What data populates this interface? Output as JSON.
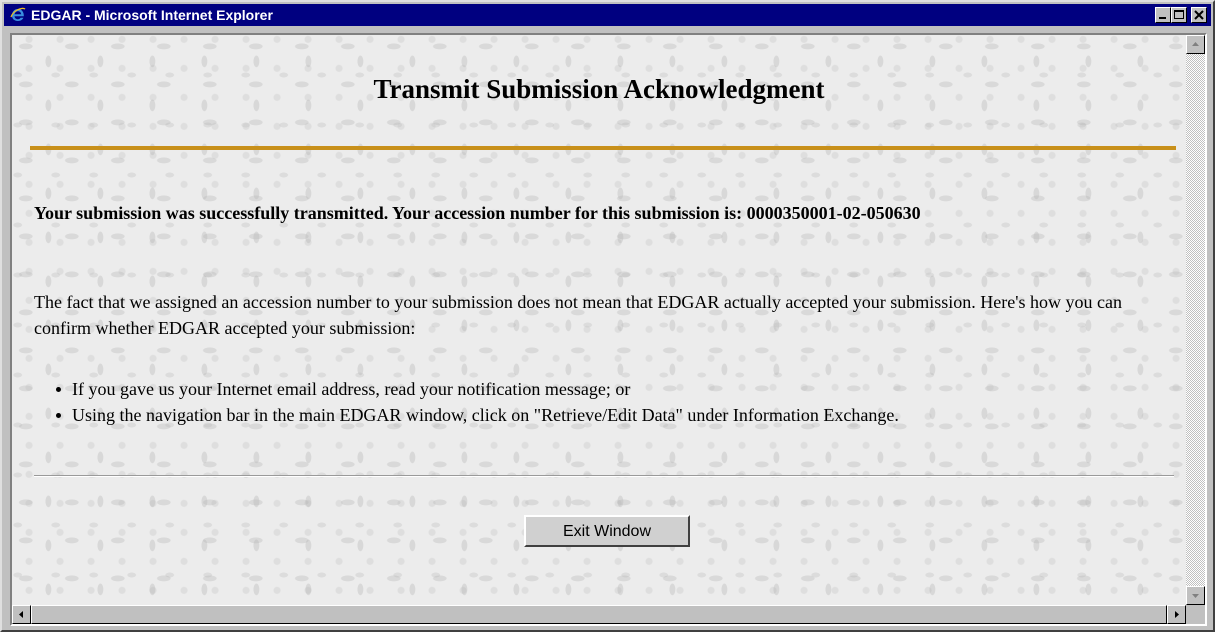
{
  "window": {
    "title": "EDGAR - Microsoft Internet Explorer",
    "icons": [
      "ie-icon",
      "minimize-icon",
      "maximize-icon",
      "close-icon"
    ]
  },
  "page": {
    "title": "Transmit Submission Acknowledgment",
    "notice": "Your submission was successfully transmitted. Your accession number for this submission is: 0000350001-02-050630",
    "body": "The fact that we assigned an accession number to your submission does not mean that EDGAR actually accepted your submission. Here's how you can confirm whether EDGAR accepted your submission:",
    "bullets": [
      "If you gave us your Internet email address, read your notification message; or",
      "Using the navigation bar in the main EDGAR window, click on \"Retrieve/Edit Data\" under Information Exchange."
    ],
    "exit_button": "Exit Window"
  },
  "colors": {
    "titlebar": "#000080",
    "gold_rule": "#c8901a",
    "chrome": "#c0c0c0"
  }
}
